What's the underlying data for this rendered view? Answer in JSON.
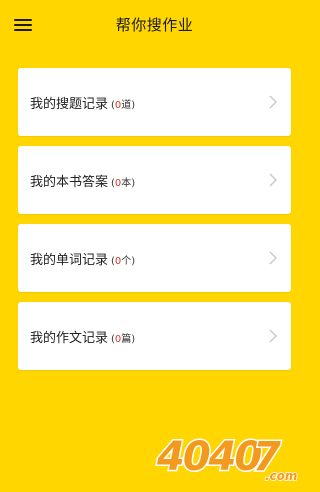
{
  "header": {
    "title": "帮你搜作业"
  },
  "records": [
    {
      "label": "我的搜题记录",
      "count_prefix": "(",
      "count": "0",
      "unit": "道",
      "count_suffix": ")"
    },
    {
      "label": "我的本书答案",
      "count_prefix": "(",
      "count": "0",
      "unit": "本",
      "count_suffix": ")"
    },
    {
      "label": "我的单词记录",
      "count_prefix": "(",
      "count": "0",
      "unit": "个",
      "count_suffix": ")"
    },
    {
      "label": "我的作文记录",
      "count_prefix": "(",
      "count": "0",
      "unit": "篇",
      "count_suffix": ")"
    }
  ],
  "watermark": {
    "text": "4040",
    "accent": "7",
    "suffix": ".com"
  },
  "colors": {
    "background": "#FFD600",
    "count_number": "#e0312b",
    "watermark_orange": "#F39A1E"
  }
}
